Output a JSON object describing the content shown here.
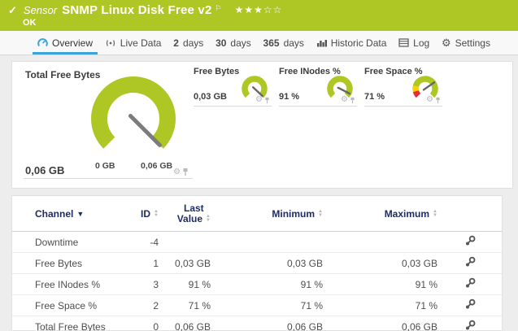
{
  "header": {
    "check_icon": "✓",
    "kind": "Sensor",
    "title": "SNMP Linux Disk Free v2",
    "flag_icon": "⚐",
    "stars_filled": "★★★",
    "stars_empty": "☆☆",
    "status": "OK"
  },
  "tabs": [
    {
      "label": "Overview"
    },
    {
      "label": "Live Data"
    },
    {
      "num": "2",
      "label": "days"
    },
    {
      "num": "30",
      "label": "days"
    },
    {
      "num": "365",
      "label": "days"
    },
    {
      "label": "Historic Data"
    },
    {
      "label": "Log"
    },
    {
      "label": "Settings"
    }
  ],
  "overview": {
    "gear_icon": "⚙",
    "main_gauge": {
      "title": "Total Free Bytes",
      "value": "0,06 GB",
      "scale_min": "0 GB",
      "scale_max": "0,06 GB",
      "needle_deg": 135
    },
    "small_gauges": [
      {
        "title": "Free Bytes",
        "value": "0,03 GB",
        "needle_deg": 133
      },
      {
        "title": "Free INodes %",
        "value": "91 %",
        "needle_deg": 117
      },
      {
        "title": "Free Space %",
        "value": "71 %",
        "needle_deg": 55
      }
    ]
  },
  "table": {
    "headers": {
      "channel": "Channel",
      "id": "ID",
      "last_line1": "Last",
      "last_line2": "Value",
      "minimum": "Minimum",
      "maximum": "Maximum"
    },
    "rows": [
      {
        "channel": "Downtime",
        "id": "-4",
        "last": "",
        "min": "",
        "max": ""
      },
      {
        "channel": "Free Bytes",
        "id": "1",
        "last": "0,03 GB",
        "min": "0,03 GB",
        "max": "0,03 GB"
      },
      {
        "channel": "Free INodes %",
        "id": "3",
        "last": "91 %",
        "min": "91 %",
        "max": "91 %"
      },
      {
        "channel": "Free Space %",
        "id": "2",
        "last": "71 %",
        "min": "71 %",
        "max": "71 %"
      },
      {
        "channel": "Total Free Bytes",
        "id": "0",
        "last": "0,06 GB",
        "min": "0,06 GB",
        "max": "0,06 GB"
      }
    ]
  },
  "colors": {
    "brand_green": "#aec724",
    "accent_blue": "#3aa4d9",
    "warn_red": "#e53030",
    "warn_yellow": "#fcd000",
    "navy_header": "#1f2b63"
  }
}
